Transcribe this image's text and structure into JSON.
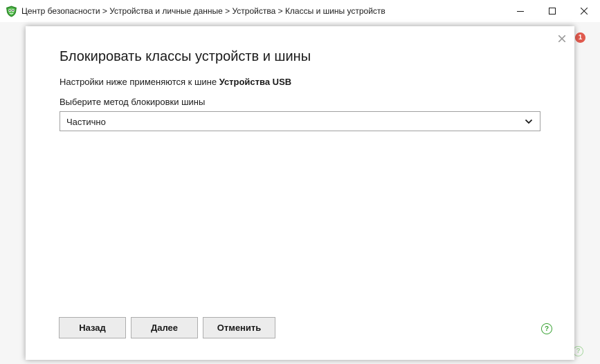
{
  "window": {
    "title": "Центр безопасности > Устройства и личные данные > Устройства > Классы и шины устройств"
  },
  "background": {
    "badge_count": "1",
    "help_glyph": "?"
  },
  "dialog": {
    "title": "Блокировать классы устройств и шины",
    "description_prefix": "Настройки ниже применяются к шине ",
    "description_bus": "Устройства USB",
    "method_label": "Выберите метод блокировки шины",
    "method_value": "Частично",
    "buttons": {
      "back": "Назад",
      "next": "Далее",
      "cancel": "Отменить"
    },
    "help_glyph": "?"
  },
  "icons": {
    "app": "shield-logo-icon",
    "minimize": "minimize-icon",
    "maximize": "maximize-icon",
    "close": "close-icon",
    "dialog_close": "close-icon",
    "dropdown": "chevron-down-icon",
    "help": "help-icon"
  },
  "colors": {
    "accent_green": "#3aa335",
    "badge_red": "#e05a4e",
    "button_bg": "#ececec"
  }
}
